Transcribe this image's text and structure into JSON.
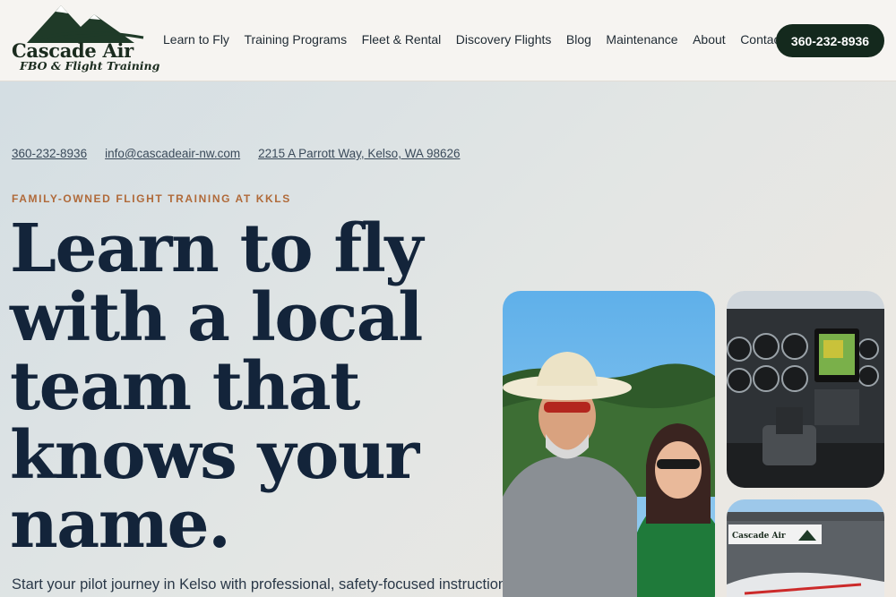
{
  "header": {
    "logo": {
      "name": "Cascade Air",
      "tagline": "FBO & Flight Training"
    },
    "nav": [
      "Learn to Fly",
      "Training Programs",
      "Fleet & Rental",
      "Discovery Flights",
      "Blog",
      "Maintenance",
      "About",
      "Contact"
    ],
    "phone_button": "360-232-8936"
  },
  "contact": {
    "phone": "360-232-8936",
    "email": "info@cascadeair-nw.com",
    "address": "2215 A Parrott Way, Kelso, WA 98626"
  },
  "hero": {
    "eyebrow": "FAMILY-OWNED FLIGHT TRAINING AT KKLS",
    "headline": "Learn to fly with a local team that knows your name.",
    "subtext": "Start your pilot journey in Kelso with professional, safety-focused instruction,"
  },
  "colors": {
    "accent": "#b06a3a",
    "brand_dark": "#14291d",
    "headline": "#13243a"
  }
}
